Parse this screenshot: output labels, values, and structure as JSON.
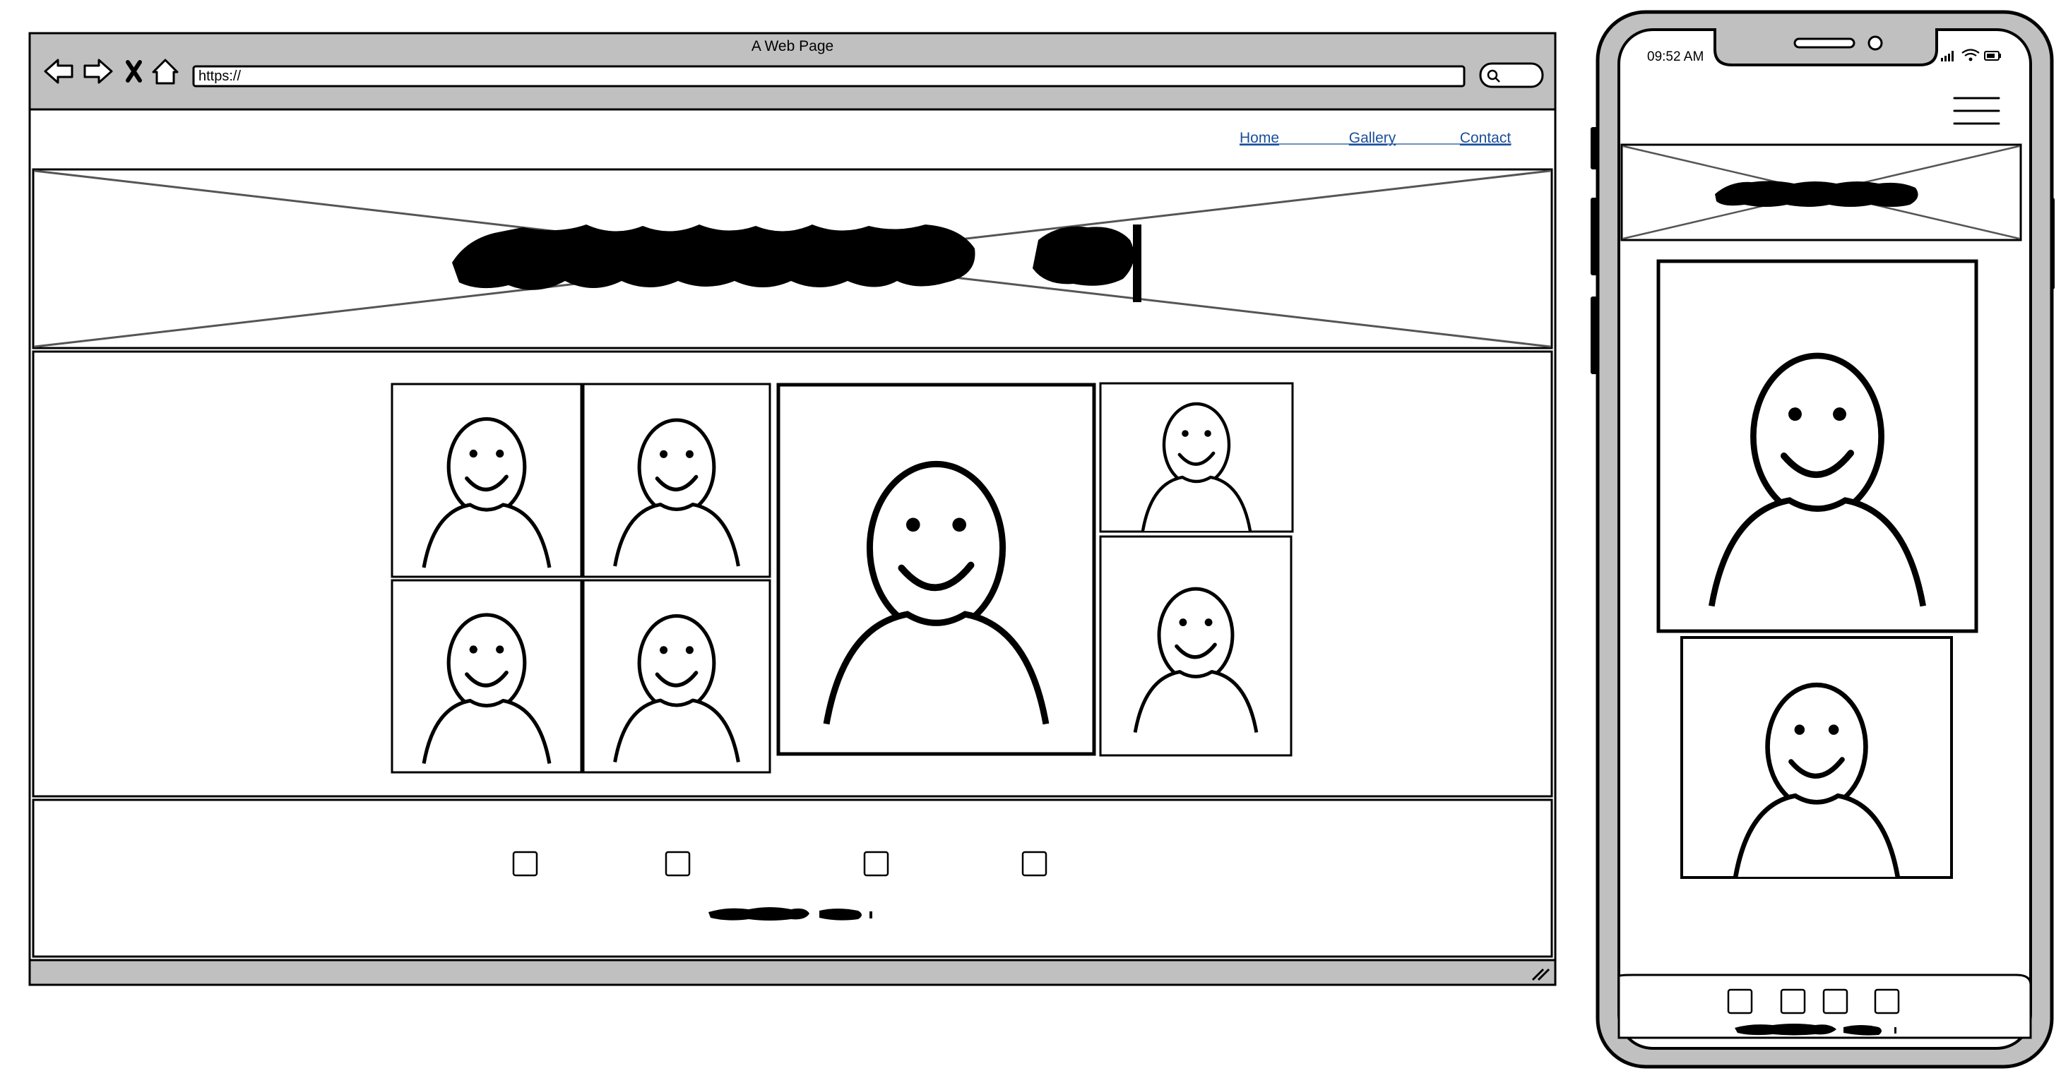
{
  "browser": {
    "title": "A Web Page",
    "url": "https://",
    "icons": [
      "back-arrow-icon",
      "forward-arrow-icon",
      "close-x-icon",
      "home-icon",
      "search-icon",
      "resize-grip-icon"
    ]
  },
  "website": {
    "nav": [
      {
        "label": "Home"
      },
      {
        "label": "Gallery"
      },
      {
        "label": "Contact"
      }
    ],
    "footer": {
      "social_icons": [
        "checkbox-icon",
        "checkbox-icon",
        "checkbox-icon",
        "checkbox-icon"
      ]
    }
  },
  "phone": {
    "status": {
      "time": "09:52 AM",
      "icons": [
        "signal-icon",
        "wifi-icon",
        "battery-icon"
      ]
    },
    "menu_icon": "hamburger-menu-icon",
    "footer": {
      "social_icons": [
        "checkbox-icon",
        "checkbox-icon",
        "checkbox-icon",
        "checkbox-icon"
      ]
    }
  },
  "colors": {
    "chrome": "#c0c0c0",
    "stroke": "#000000",
    "link": "#1a4f9c",
    "placeholder_x": "#555555"
  }
}
